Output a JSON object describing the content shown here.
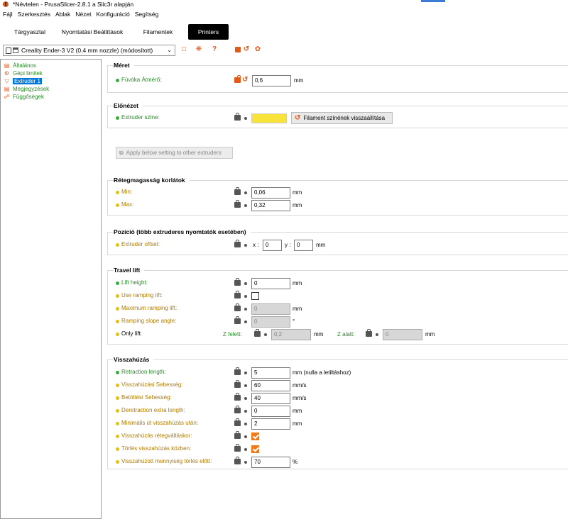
{
  "window": {
    "title": "*Névtelen - PrusaSlicer-2.8.1 a Slic3r alapján"
  },
  "menu": [
    "Fájl",
    "Szerkesztés",
    "Ablak",
    "Nézet",
    "Konfiguráció",
    "Segítség"
  ],
  "tabs": [
    "Tárgyasztal",
    "Nyomtatási Beállítások",
    "Filamentek",
    "Printers"
  ],
  "active_tab": "Printers",
  "preset": {
    "name": "Creality Ender-3 V2 (0.4 mm nozzle) (módosított)"
  },
  "toolbar_icons": [
    "save-icon",
    "compare-icon",
    "help-icon",
    "unlock-icon",
    "undo-icon",
    "settings-icon"
  ],
  "nav": [
    {
      "label": "Általános",
      "icon": "printer-icon"
    },
    {
      "label": "Gépi limitek",
      "icon": "gear-icon"
    },
    {
      "label": "Extruder 1",
      "icon": "funnel-icon"
    },
    {
      "label": "Megjegyzések",
      "icon": "note-icon"
    },
    {
      "label": "Függőségek",
      "icon": "link-icon"
    }
  ],
  "groups": {
    "size": {
      "title": "Méret",
      "nozzle": {
        "label": "Fúvóka Átmérő:",
        "value": "0,6",
        "unit": "mm"
      }
    },
    "preview": {
      "title": "Előnézet",
      "color_label": "Extruder színe:",
      "color": "#f7e33a",
      "reset_button": "Filament színének visszaállítása"
    },
    "apply_button": "Apply below setting to other extruders",
    "layer": {
      "title": "Rétegmagasság korlátok",
      "min": {
        "label": "Min:",
        "value": "0,06",
        "unit": "mm"
      },
      "max": {
        "label": "Max:",
        "value": "0,32",
        "unit": "mm"
      }
    },
    "position": {
      "title": "Pozíció (több extruderes nyomtatók esetében)",
      "offset": {
        "label": "Extruder offset:",
        "x_label": "x :",
        "x": "0",
        "y_label": "y :",
        "y": "0",
        "unit": "mm"
      }
    },
    "travel": {
      "title": "Travel lift",
      "lift_height": {
        "label": "Lift height:",
        "value": "0",
        "unit": "mm"
      },
      "ramping": {
        "label": "Use ramping lift:"
      },
      "max_ramping": {
        "label": "Maximum ramping lift:",
        "value": "0",
        "unit": "mm"
      },
      "slope": {
        "label": "Ramping slope angle:",
        "value": "0",
        "unit": "°"
      },
      "only_lift": {
        "label": "Only lift:",
        "above_label": "Z felett:",
        "above": "0,2",
        "above_unit": "mm",
        "below_label": "Z alatt:",
        "below": "0",
        "below_unit": "mm"
      }
    },
    "retraction": {
      "title": "Visszahúzás",
      "length": {
        "label": "Retraction length:",
        "value": "5",
        "unit": "mm (nulla a letiltáshoz)"
      },
      "speed": {
        "label": "Visszahúzási Sebesség:",
        "value": "60",
        "unit": "mm/s"
      },
      "load_speed": {
        "label": "Betöltési Sebesség:",
        "value": "40",
        "unit": "mm/s"
      },
      "extra": {
        "label": "Deretraction extra length:",
        "value": "0",
        "unit": "mm"
      },
      "min_travel": {
        "label": "Minimális út visszahúzás után:",
        "value": "2",
        "unit": "mm"
      },
      "layer_change": {
        "label": "Visszahúzás rétegváltáskor:",
        "checked": true
      },
      "wipe": {
        "label": "Törlés visszahúzás közben:",
        "checked": true
      },
      "before_wipe": {
        "label": "Visszahúzott mennyiség törlés előtt:",
        "value": "70",
        "unit": "%"
      }
    }
  }
}
